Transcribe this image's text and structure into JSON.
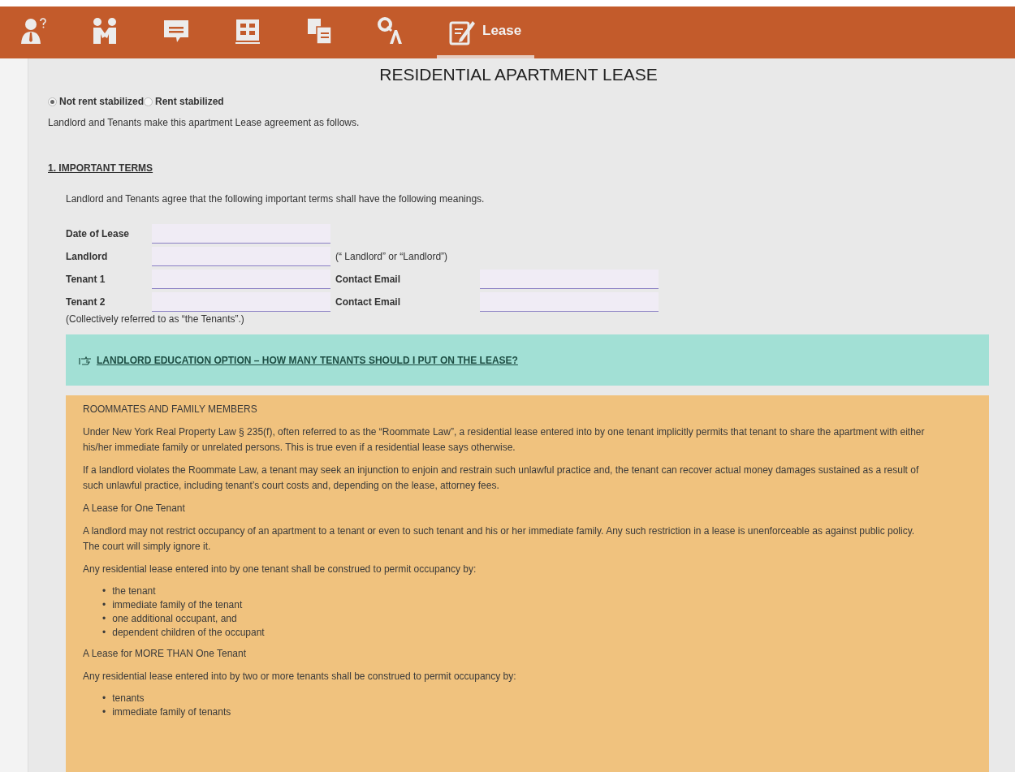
{
  "nav": {
    "tabs": [
      {
        "kind": "advisor",
        "selected": false
      },
      {
        "kind": "handshake",
        "selected": false
      },
      {
        "kind": "quote",
        "selected": false
      },
      {
        "kind": "building",
        "selected": false
      },
      {
        "kind": "compare",
        "selected": false
      },
      {
        "kind": "qa",
        "selected": false
      },
      {
        "kind": "lease",
        "label": "Lease",
        "selected": true
      }
    ]
  },
  "title": "RESIDENTIAL APARTMENT LEASE",
  "stabilization": [
    {
      "label": "Not rent stabilized",
      "selected": true
    },
    {
      "label": "Rent stabilized",
      "selected": false
    }
  ],
  "intro": "Landlord and Tenants make this apartment Lease agreement as follows.",
  "section": {
    "heading": "1. IMPORTANT TERMS",
    "text": "Landlord and Tenants agree that the following important terms shall have the following meanings.",
    "rows": [
      {
        "label": "Date of Lease"
      },
      {
        "label": "Landlord",
        "note": "(“ Landlord” or “Landlord”)"
      },
      {
        "label": "Tenant 1",
        "email_label": "Contact Email"
      },
      {
        "label": "Tenant 2",
        "email_label": "Contact Email"
      }
    ],
    "footnote": "(Collectively referred to as “the Tenants”.)"
  },
  "education": {
    "link": "LANDLORD EDUCATION OPTION – HOW MANY TENANTS SHOULD I PUT ON THE LEASE?",
    "blocks": [
      {
        "kind": "heading",
        "text": "ROOMMATES AND FAMILY MEMBERS"
      },
      {
        "kind": "paragraph",
        "text": "Under New York Real Property Law § 235(f), often referred to as the “Roommate Law”, a residential lease entered into by one tenant implicitly permits that tenant to share the apartment with either his/her immediate family or unrelated persons. This is true even if a residential lease says otherwise."
      },
      {
        "kind": "paragraph",
        "text": "If a landlord violates the Roommate Law, a tenant may seek an injunction to enjoin and restrain such unlawful practice and, the tenant can recover actual money damages sustained as a result of such unlawful practice, including tenant’s court costs and, depending on the lease, attorney fees."
      },
      {
        "kind": "heading",
        "text": "A Lease for One Tenant"
      },
      {
        "kind": "paragraph",
        "text": "A landlord may not restrict occupancy of an apartment to a tenant or even to such tenant and his or her immediate family. Any such restriction in a lease is unenforceable as against public policy. The court will simply ignore it."
      },
      {
        "kind": "paragraph",
        "text": "Any residential lease entered into by one tenant shall be construed to permit occupancy by:"
      },
      {
        "kind": "list",
        "marker": "•",
        "items": [
          "the tenant",
          "immediate family of the tenant",
          "one additional occupant, and",
          "dependent children of the occupant"
        ]
      },
      {
        "kind": "heading",
        "text": "A Lease for MORE THAN One Tenant"
      },
      {
        "kind": "paragraph",
        "text": "Any residential lease entered into by two or more tenants shall be construed to permit occupancy by:"
      },
      {
        "kind": "list",
        "marker": "•",
        "items": [
          "tenants",
          "immediate family of tenants"
        ]
      }
    ]
  }
}
